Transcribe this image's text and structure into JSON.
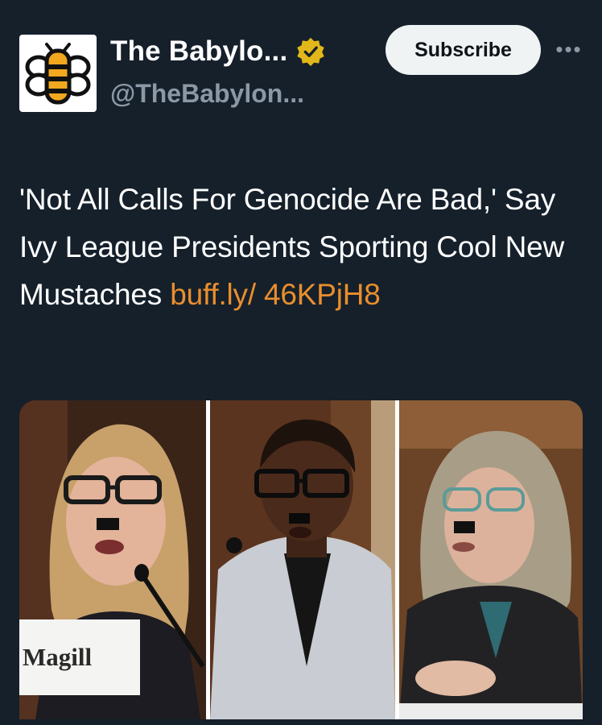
{
  "author": {
    "display_name": "The Babylo...",
    "handle": "@TheBabylon...",
    "avatar_icon": "bee-icon",
    "verified_icon": "verified-badge-icon",
    "verified_color": "#e2b719"
  },
  "actions": {
    "subscribe_label": "Subscribe",
    "more_icon": "more-options-icon",
    "more_label": "•••"
  },
  "tweet": {
    "text": "'Not All Calls For Genocide Are Bad,' Say Ivy League Presidents Sporting Cool New Mustaches ",
    "link_text": "buff.ly/ 46KPjH8",
    "link_color": "#e98e2e"
  },
  "media": {
    "nameplate_text": "Magill"
  },
  "colors": {
    "background": "#15202b",
    "secondary_text": "#8b98a5",
    "subscribe_bg": "#eff3f4"
  }
}
